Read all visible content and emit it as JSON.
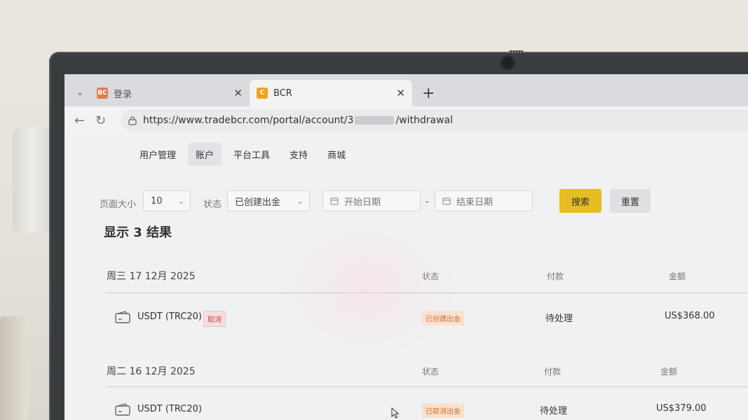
{
  "browser": {
    "tabs": [
      {
        "label": "登录",
        "favicon": "BC",
        "active": false
      },
      {
        "label": "BCR",
        "favicon": "C",
        "active": true
      }
    ],
    "url_prefix": "https://www.tradebcr.com/portal/account/3",
    "url_suffix": "/withdrawal"
  },
  "nav": {
    "items": [
      "用户管理",
      "账户",
      "平台工具",
      "支持",
      "商城"
    ],
    "active_index": 1
  },
  "filters": {
    "page_size_label": "页面大小",
    "page_size_value": "10",
    "status_label": "状态",
    "status_value": "已创建出金",
    "start_date_placeholder": "开始日期",
    "date_separator": "-",
    "end_date_placeholder": "结束日期",
    "search_label": "搜索",
    "reset_label": "重置"
  },
  "results": {
    "title": "显示 3 结果",
    "groups": [
      {
        "date": "周三 17 12月 2025",
        "col_status": "状态",
        "col_payment": "付款",
        "col_amount": "金额",
        "row": {
          "method": "USDT (TRC20)",
          "cancel_label": "取消",
          "status": "已创建出金",
          "payment": "待处理",
          "amount": "US$368.00"
        }
      },
      {
        "date": "周二 16 12月 2025",
        "col_status": "状态",
        "col_payment": "付款",
        "col_amount": "金额",
        "row": {
          "method": "USDT (TRC20)",
          "status": "已取消出金",
          "payment": "待处理",
          "amount": "US$379.00"
        }
      }
    ]
  },
  "colors": {
    "search_button": "#e7bd22",
    "status_badge_text": "#d26d2a",
    "cancel_badge_text": "#c84444"
  }
}
